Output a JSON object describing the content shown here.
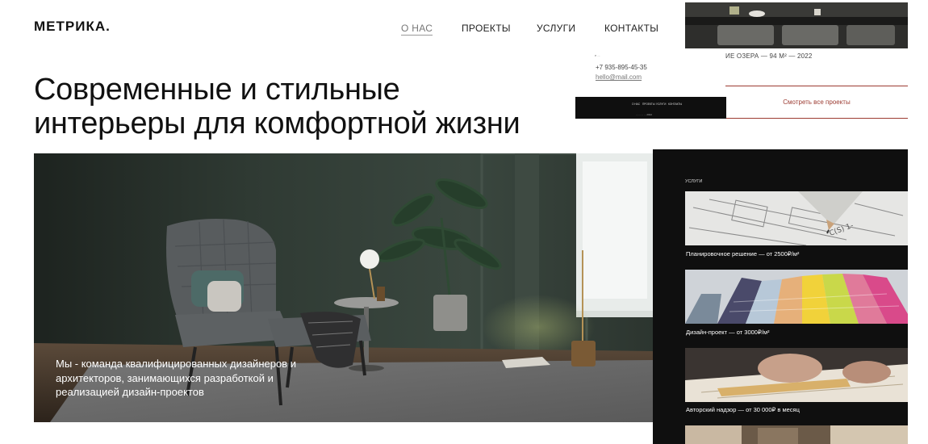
{
  "header": {
    "logo": "МЕТРИКА.",
    "nav": [
      "О НАС",
      "ПРОЕКТЫ",
      "УСЛУГИ",
      "КОНТАКТЫ"
    ]
  },
  "hero": {
    "title_line1": "Современные и стильные",
    "title_line2": "интерьеры для комфортной жизни",
    "description": "Мы - команда квалифицированных дизайнеров и архитекторов, занимающихся разработкой и реализацией дизайн-проектов"
  },
  "project": {
    "caption": "ИЕ ОЗЕРА — 94 М² — 2022",
    "all_projects": "Смотреть все проекты"
  },
  "contacts": {
    "small_label": "e ... ",
    "phone": "+7 935-895-45-35",
    "email": "hello@mail.com"
  },
  "footer": {
    "nav": [
      "О НАС",
      "ПРОЕКТЫ",
      "УСЛУГИ",
      "КОНТАКТЫ"
    ],
    "copyright": "... ... ... ... 2022"
  },
  "services": {
    "title": "УСЛУГИ",
    "items": [
      {
        "caption": "Планировочное решение — от 2500₽/м²"
      },
      {
        "caption": "Дизайн-проект — от 3000₽/м²"
      },
      {
        "caption": "Авторский надзор — от 30 000₽ в месяц"
      }
    ]
  },
  "colors": {
    "accent": "#9c3b32",
    "dark_bg": "#0f0f0f",
    "text": "#111111"
  }
}
